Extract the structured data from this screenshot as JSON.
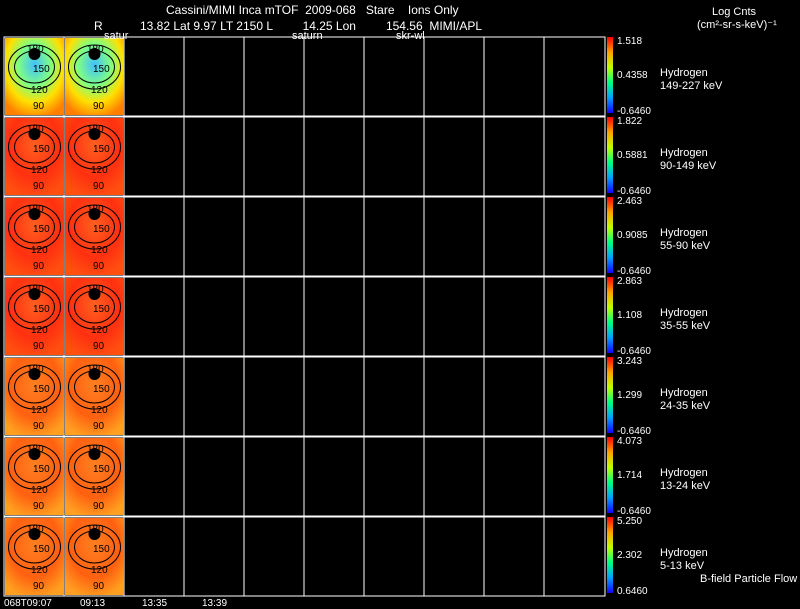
{
  "header": {
    "line1": "Cassini/MIMI Inca mTOF  2009-068   Stare    Ions Only",
    "r_label": "R",
    "line2": "13.82 Lat 9.97 LT 2150 L         14.25 Lon         154.56  MIMI/APL",
    "sub_labels": [
      "satur",
      "saturn",
      "skr-wl"
    ],
    "units_title": "Log Cnts",
    "units": "(cm²-sr-s-keV)⁻¹"
  },
  "panels": [
    {
      "species": "Hydrogen",
      "energy": "149-227 keV",
      "max": "1.518",
      "mid": "0.4358",
      "min": "-0.6460",
      "tint": "cool"
    },
    {
      "species": "Hydrogen",
      "energy": "90-149 keV",
      "max": "1.822",
      "mid": "0.5881",
      "min": "-0.6460",
      "tint": "warm"
    },
    {
      "species": "Hydrogen",
      "energy": "55-90 keV",
      "max": "2.463",
      "mid": "0.9085",
      "min": "-0.6460",
      "tint": "warm"
    },
    {
      "species": "Hydrogen",
      "energy": "35-55 keV",
      "max": "2.863",
      "mid": "1.108",
      "min": "-0.6460",
      "tint": "warm"
    },
    {
      "species": "Hydrogen",
      "energy": "24-35 keV",
      "max": "3.243",
      "mid": "1.299",
      "min": "-0.6460",
      "tint": "orange"
    },
    {
      "species": "Hydrogen",
      "energy": "13-24 keV",
      "max": "4.073",
      "mid": "1.714",
      "min": "-0.6460",
      "tint": "orange"
    },
    {
      "species": "Hydrogen",
      "energy": "5-13 keV",
      "max": "5.250",
      "mid": "2.302",
      "min": "0.6460",
      "tint": "orange"
    }
  ],
  "contours": [
    "180",
    "150",
    "120",
    "90"
  ],
  "time_labels": [
    "068T09:07",
    "09:13",
    "13:35",
    "13:39"
  ],
  "footer": {
    "legend": "B-field Particle Flow"
  },
  "colors": {
    "background": "#000000",
    "grid": "#ffffff"
  }
}
